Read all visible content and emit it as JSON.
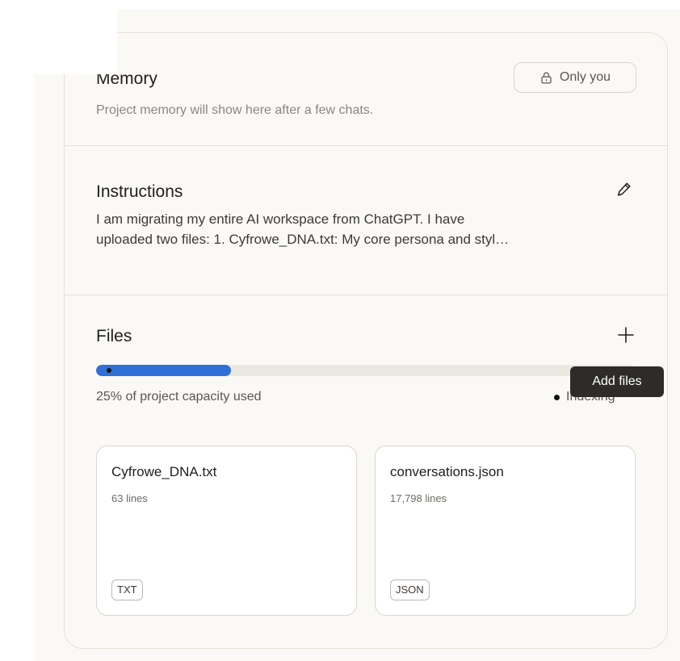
{
  "memory": {
    "title": "Memory",
    "subtitle": "Project memory will show here after a few chats.",
    "visibility_label": "Only you"
  },
  "instructions": {
    "title": "Instructions",
    "line1": "I am migrating my entire AI workspace from ChatGPT. I have",
    "line2": "uploaded two files: 1. Cyfrowe_DNA.txt: My core persona and styl…"
  },
  "files": {
    "title": "Files",
    "add_tooltip": "Add files",
    "capacity_text": "25% of project capacity used",
    "capacity_fraction": 0.25,
    "status_text": "Indexing",
    "items": [
      {
        "name": "Cyfrowe_DNA.txt",
        "lines": "63 lines",
        "type": "TXT"
      },
      {
        "name": "conversations.json",
        "lines": "17,798 lines",
        "type": "JSON"
      }
    ]
  },
  "colors": {
    "progress_fill": "#2f6fd8",
    "card_background": "#faf9f6",
    "tooltip_background": "#2d2c2a"
  },
  "icons": {
    "visibility": "lock-icon",
    "edit": "pencil-icon",
    "add": "plus-icon"
  }
}
